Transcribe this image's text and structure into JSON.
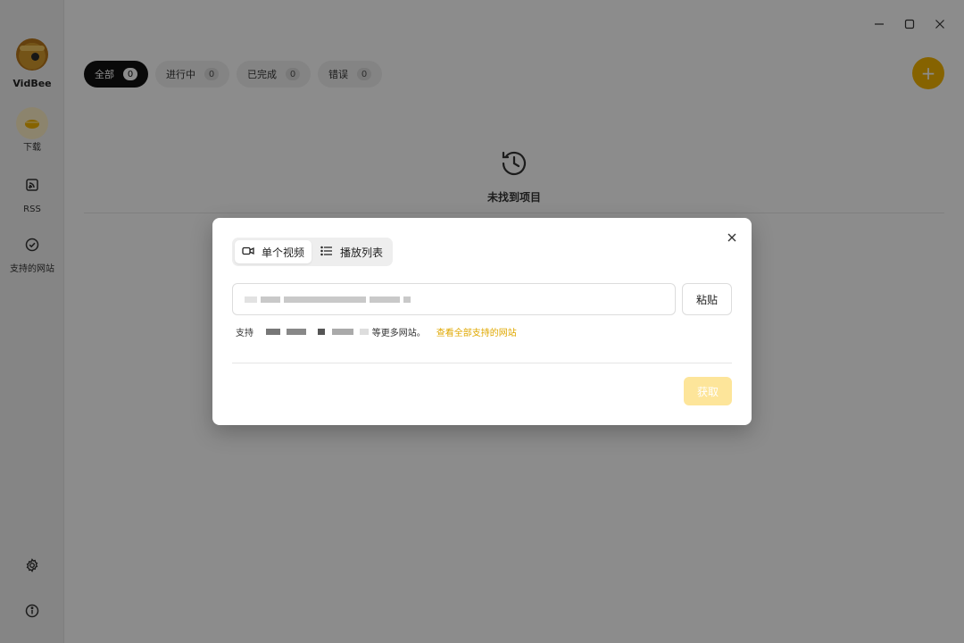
{
  "app": {
    "name": "VidBee"
  },
  "sidebar": {
    "items": [
      {
        "label": "下载",
        "icon": "download-icon"
      },
      {
        "label": "RSS",
        "icon": "rss-icon"
      },
      {
        "label": "支持的网站",
        "icon": "check-circle-icon"
      }
    ],
    "bottom": [
      {
        "icon": "gear-icon"
      },
      {
        "icon": "info-icon"
      }
    ]
  },
  "filters": [
    {
      "label": "全部",
      "count": "0"
    },
    {
      "label": "进行中",
      "count": "0"
    },
    {
      "label": "已完成",
      "count": "0"
    },
    {
      "label": "错误",
      "count": "0"
    }
  ],
  "empty_state": {
    "text": "未找到项目",
    "icon": "history-icon"
  },
  "add_button": {
    "symbol": "+"
  },
  "dialog": {
    "tabs": [
      {
        "label": "单个视频",
        "icon": "video-icon"
      },
      {
        "label": "播放列表",
        "icon": "list-icon"
      }
    ],
    "paste_label": "粘贴",
    "support_prefix": "支持",
    "support_suffix": "等更多网站。",
    "support_link": "查看全部支持的网站",
    "fetch_label": "获取"
  },
  "colors": {
    "accent": "#f4b400",
    "link": "#e0a800",
    "fetch_disabled": "#fde59a"
  }
}
